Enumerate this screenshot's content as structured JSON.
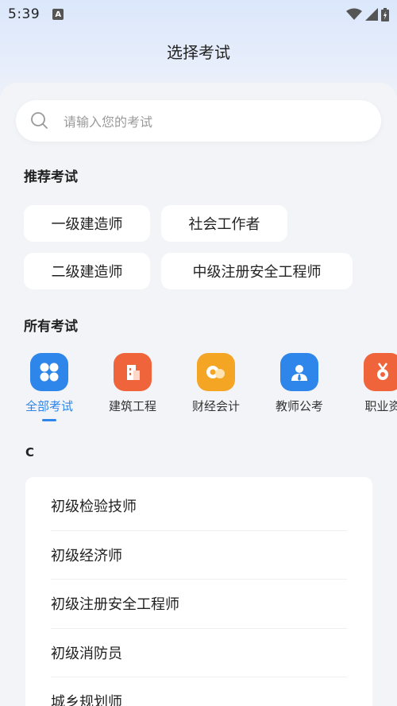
{
  "status_bar": {
    "time": "5:39",
    "notification_glyph": "A"
  },
  "header": {
    "title": "选择考试"
  },
  "search": {
    "placeholder": "请输入您的考试"
  },
  "recommended": {
    "title": "推荐考试",
    "items": [
      "一级建造师",
      "社会工作者",
      "二级建造师",
      "中级注册安全工程师"
    ]
  },
  "all_exams": {
    "title": "所有考试",
    "categories": [
      {
        "label": "全部考试",
        "icon": "grid-icon",
        "color": "#2f86ea",
        "active": true
      },
      {
        "label": "建筑工程",
        "icon": "building-icon",
        "color": "#f0643c",
        "active": false
      },
      {
        "label": "财经会计",
        "icon": "coins-icon",
        "color": "#f5a524",
        "active": false
      },
      {
        "label": "教师公考",
        "icon": "person-icon",
        "color": "#2f86ea",
        "active": false
      },
      {
        "label": "职业资",
        "icon": "medal-icon",
        "color": "#f0643c",
        "active": false
      }
    ]
  },
  "list": {
    "letter": "C",
    "items": [
      "初级检验技师",
      "初级经济师",
      "初级注册安全工程师",
      "初级消防员",
      "城乡规划师"
    ]
  }
}
